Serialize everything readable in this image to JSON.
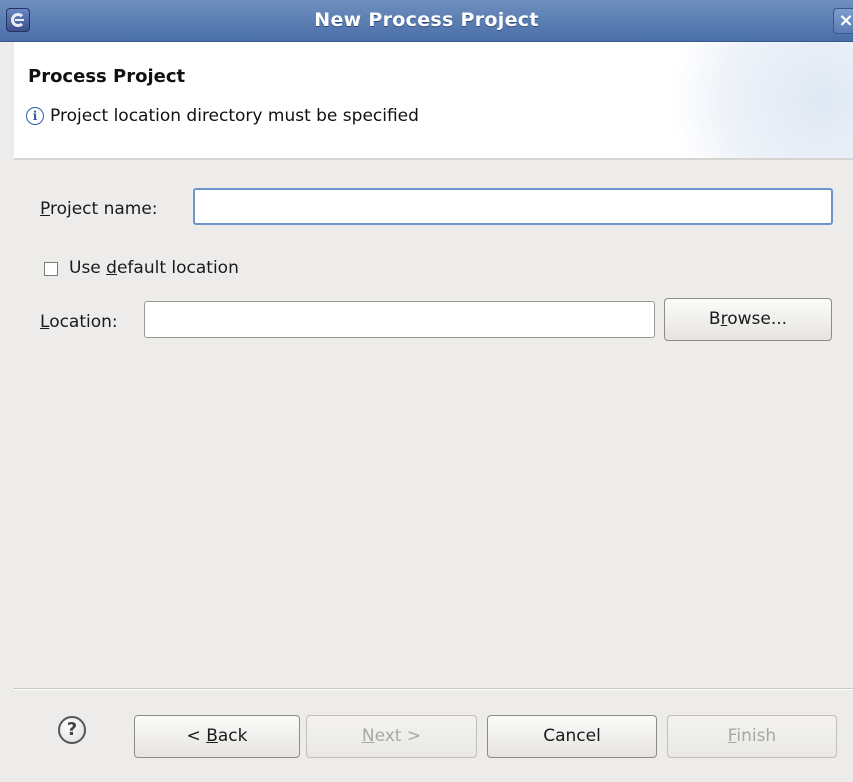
{
  "window": {
    "title": "New Process Project",
    "close_glyph": "×",
    "icon": "eclipse-icon"
  },
  "header": {
    "title": "Process Project",
    "message": "Project location directory must be specified",
    "message_icon": "info-icon"
  },
  "form": {
    "project_name": {
      "label_mnemonic": "P",
      "label_rest": "roject name:",
      "value": ""
    },
    "use_default": {
      "label_pre": "Use ",
      "label_mnemonic": "d",
      "label_rest": "efault location",
      "checked": false
    },
    "location": {
      "label_mnemonic": "L",
      "label_rest": "ocation:",
      "value": ""
    },
    "browse": {
      "pre": "B",
      "mnemonic": "r",
      "rest": "owse..."
    }
  },
  "footer": {
    "help_glyph": "?",
    "back": {
      "pre": "< ",
      "mnemonic": "B",
      "rest": "ack"
    },
    "next": {
      "mnemonic": "N",
      "rest": "ext >"
    },
    "cancel": {
      "label": "Cancel"
    },
    "finish": {
      "mnemonic": "F",
      "rest": "inish"
    }
  }
}
